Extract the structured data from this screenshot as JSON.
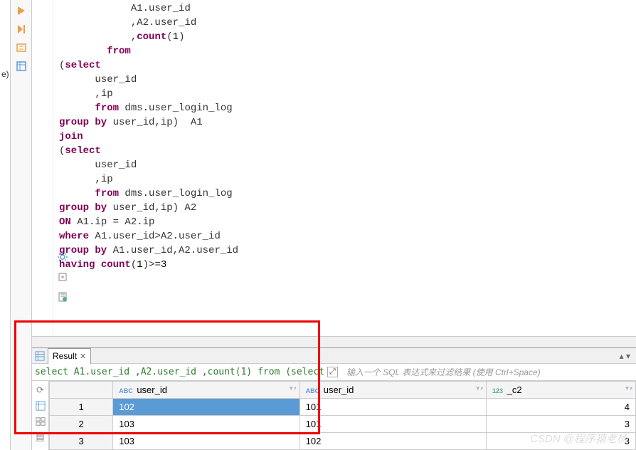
{
  "editor": {
    "code_lines": [
      {
        "indent": 12,
        "tokens": [
          {
            "t": "A1.user_id",
            "c": "ident"
          }
        ]
      },
      {
        "indent": 12,
        "tokens": [
          {
            "t": ",A2.user_id",
            "c": "ident"
          }
        ]
      },
      {
        "indent": 12,
        "tokens": [
          {
            "t": ",",
            "c": "ident"
          },
          {
            "t": "count",
            "c": "kw"
          },
          {
            "t": "(",
            "c": "ident"
          },
          {
            "t": "1",
            "c": "num"
          },
          {
            "t": ")",
            "c": "ident"
          }
        ]
      },
      {
        "indent": 8,
        "tokens": [
          {
            "t": "from",
            "c": "kw"
          }
        ]
      },
      {
        "indent": 0,
        "tokens": [
          {
            "t": "(",
            "c": "ident"
          },
          {
            "t": "select",
            "c": "kw"
          }
        ]
      },
      {
        "indent": 6,
        "tokens": [
          {
            "t": "user_id",
            "c": "ident"
          }
        ]
      },
      {
        "indent": 6,
        "tokens": [
          {
            "t": ",ip",
            "c": "ident"
          }
        ]
      },
      {
        "indent": 6,
        "tokens": [
          {
            "t": "from",
            "c": "kw"
          },
          {
            "t": " dms.user_login_log",
            "c": "ident"
          }
        ]
      },
      {
        "indent": 0,
        "tokens": [
          {
            "t": "group by",
            "c": "kw"
          },
          {
            "t": " user_id,ip)  A1",
            "c": "ident"
          }
        ]
      },
      {
        "indent": 0,
        "tokens": [
          {
            "t": "join",
            "c": "kw"
          }
        ]
      },
      {
        "indent": 0,
        "tokens": [
          {
            "t": "(",
            "c": "ident"
          },
          {
            "t": "select",
            "c": "kw"
          }
        ]
      },
      {
        "indent": 6,
        "tokens": [
          {
            "t": "user_id",
            "c": "ident"
          }
        ]
      },
      {
        "indent": 6,
        "tokens": [
          {
            "t": ",ip",
            "c": "ident"
          }
        ]
      },
      {
        "indent": 6,
        "tokens": [
          {
            "t": "from",
            "c": "kw"
          },
          {
            "t": " dms.user_login_log",
            "c": "ident"
          }
        ]
      },
      {
        "indent": 0,
        "tokens": [
          {
            "t": "group by",
            "c": "kw"
          },
          {
            "t": " user_id,ip) A2",
            "c": "ident"
          }
        ]
      },
      {
        "indent": 0,
        "tokens": [
          {
            "t": "ON",
            "c": "kw"
          },
          {
            "t": " A1.ip = A2.ip",
            "c": "ident"
          }
        ]
      },
      {
        "indent": 0,
        "tokens": [
          {
            "t": "where",
            "c": "kw"
          },
          {
            "t": " A1.user_id>A2.user_id",
            "c": "ident"
          }
        ]
      },
      {
        "indent": 0,
        "tokens": [
          {
            "t": "",
            "c": "ident"
          }
        ]
      },
      {
        "indent": 0,
        "tokens": [
          {
            "t": "group by",
            "c": "kw"
          },
          {
            "t": " A1.user_id,A2.user_id",
            "c": "ident"
          }
        ]
      },
      {
        "indent": 0,
        "tokens": [
          {
            "t": "having",
            "c": "kw"
          },
          {
            "t": " ",
            "c": "ident"
          },
          {
            "t": "count",
            "c": "kw"
          },
          {
            "t": "(",
            "c": "ident"
          },
          {
            "t": "1",
            "c": "num"
          },
          {
            "t": ")>=",
            "c": "ident"
          },
          {
            "t": "3",
            "c": "num"
          }
        ]
      }
    ]
  },
  "truncated_left_text": "e)",
  "result": {
    "tab_label": "Result",
    "query_preview": "select A1.user_id ,A2.user_id ,count(1) from (select",
    "filter_placeholder": "输入一个 SQL 表达式来过滤结果 (使用 Ctrl+Space)",
    "columns": [
      {
        "label": "user_id",
        "type": "ABC"
      },
      {
        "label": "user_id",
        "type": "ABC"
      },
      {
        "label": "_c2",
        "type": "123"
      }
    ],
    "rows": [
      {
        "n": "1",
        "cells": [
          "102",
          "101",
          "4"
        ],
        "selected_col": 0
      },
      {
        "n": "2",
        "cells": [
          "103",
          "101",
          "3"
        ]
      },
      {
        "n": "3",
        "cells": [
          "103",
          "102",
          "3"
        ]
      }
    ]
  },
  "watermark": "CSDN @程序猿老杨"
}
